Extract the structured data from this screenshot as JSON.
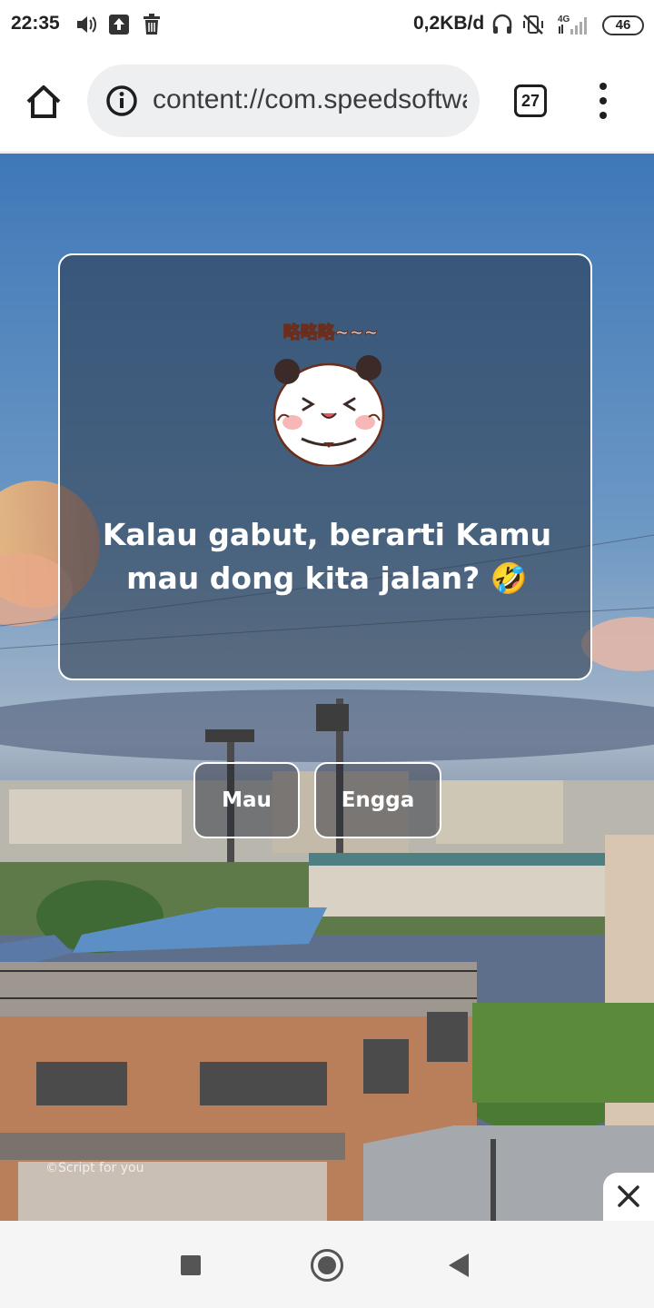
{
  "status_bar": {
    "time": "22:35",
    "net_speed": "0,2KB/d",
    "network": "4G",
    "battery": "46",
    "icons": [
      "volume-icon",
      "upload-icon",
      "trash-icon",
      "headset-icon",
      "vibrate-off-icon",
      "signal-icon",
      "battery-icon"
    ]
  },
  "browser": {
    "url": "content://com.speedsoftware.rootexplorer.content/storage/index.html",
    "tab_count": "27",
    "icons": [
      "home-icon",
      "info-icon",
      "tabs-icon",
      "more-vert-icon"
    ]
  },
  "page": {
    "sticker_caption": "略略略~~~",
    "message": "Kalau gabut, berarti Kamu mau dong kita jalan? 🤣",
    "buttons": {
      "yes": "Mau",
      "no": "Engga"
    },
    "watermark": "©Script for you"
  },
  "ad": {
    "close_icon": "close-icon"
  },
  "nav_bar": {
    "icons": [
      "recents-icon",
      "home-icon",
      "back-icon"
    ]
  },
  "colors": {
    "card_border": "#ffffff",
    "button_text": "#ffffff",
    "url_bar_bg": "#eeeff1"
  }
}
